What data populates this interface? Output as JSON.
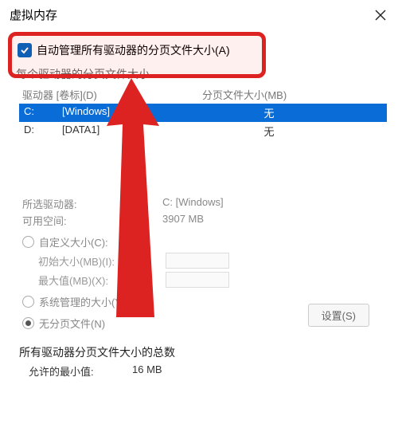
{
  "window": {
    "title": "虚拟内存"
  },
  "auto_manage": {
    "label": "自动管理所有驱动器的分页文件大小(A)",
    "checked": true
  },
  "under_label": "每个驱动器的分页文件大小",
  "headers": {
    "drive": "驱动器 [卷标](D)",
    "paging": "分页文件大小(MB)"
  },
  "drives": [
    {
      "letter": "C:",
      "label": "[Windows]",
      "paging": "无",
      "selected": true
    },
    {
      "letter": "D:",
      "label": "[DATA1]",
      "paging": "无",
      "selected": false
    }
  ],
  "selected_info": {
    "drive_label": "所选驱动器:",
    "drive_value": "C:   [Windows]",
    "space_label": "可用空间:",
    "space_value": "3907 MB"
  },
  "options": {
    "custom": {
      "label": "自定义大小(C):"
    },
    "initial": {
      "label": "初始大小(MB)(I):"
    },
    "max": {
      "label": "最大值(MB)(X):"
    },
    "system": {
      "label": "系统管理的大小(Y)"
    },
    "none": {
      "label": "无分页文件(N)",
      "selected": true
    }
  },
  "set_button": "设置(S)",
  "summary": {
    "title": "所有驱动器分页文件大小的总数",
    "min_label": "允许的最小值:",
    "min_value": "16 MB"
  }
}
